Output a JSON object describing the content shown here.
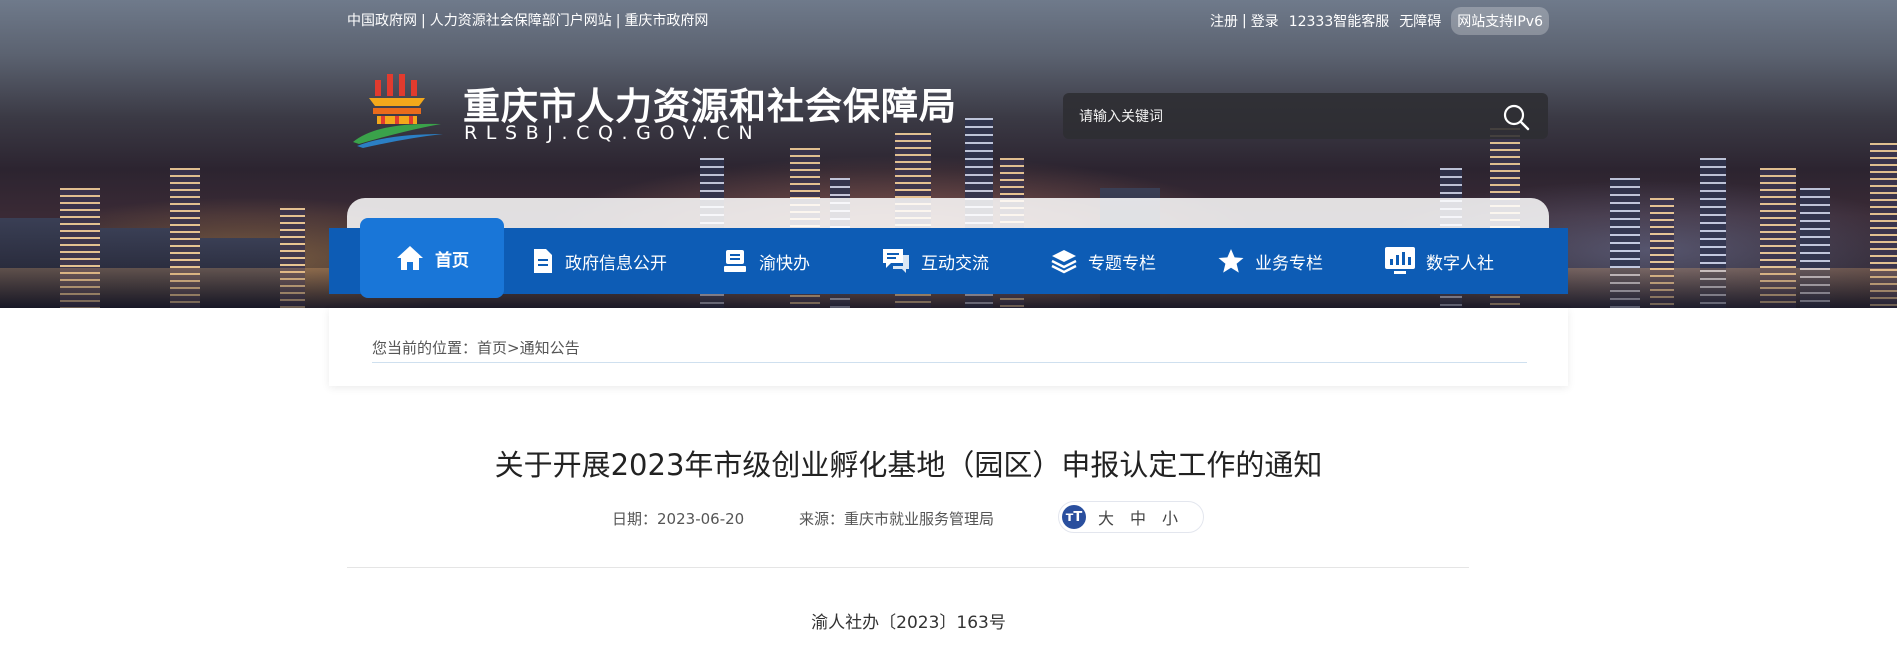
{
  "top_links_left": [
    "中国政府网",
    "人力资源社会保障部门户网站",
    "重庆市政府网"
  ],
  "top_links_right": {
    "register": "注册",
    "login": "登录",
    "service": "12333智能客服",
    "accessibility": "无障碍",
    "ipv6": "网站支持IPv6"
  },
  "site": {
    "title": "重庆市人力资源和社会保障局",
    "subtitle": "RLSBJ.CQ.GOV.CN"
  },
  "search": {
    "placeholder": "请输入关键词"
  },
  "nav": {
    "items": [
      {
        "label": "首页",
        "icon": "home-icon"
      },
      {
        "label": "政府信息公开",
        "icon": "document-icon"
      },
      {
        "label": "渝快办",
        "icon": "stamp-icon"
      },
      {
        "label": "互动交流",
        "icon": "chat-icon"
      },
      {
        "label": "专题专栏",
        "icon": "layers-icon"
      },
      {
        "label": "业务专栏",
        "icon": "star-icon"
      },
      {
        "label": "数字人社",
        "icon": "monitor-chart-icon"
      }
    ],
    "active": "首页"
  },
  "breadcrumb": {
    "prefix": "您当前的位置：",
    "home": "首页",
    "separator": ">",
    "current": "通知公告"
  },
  "article": {
    "title": "关于开展2023年市级创业孵化基地（园区）申报认定工作的通知",
    "date_label": "日期：",
    "date": "2023-06-20",
    "source_label": "来源：",
    "source": "重庆市就业服务管理局",
    "font_sizes": [
      "大",
      "中",
      "小"
    ],
    "doc_number": "渝人社办〔2023〕163号"
  },
  "colors": {
    "nav_bg": "#0d5cb5",
    "nav_active": "#1976d8",
    "font_toggle": "#2a4f9e"
  }
}
